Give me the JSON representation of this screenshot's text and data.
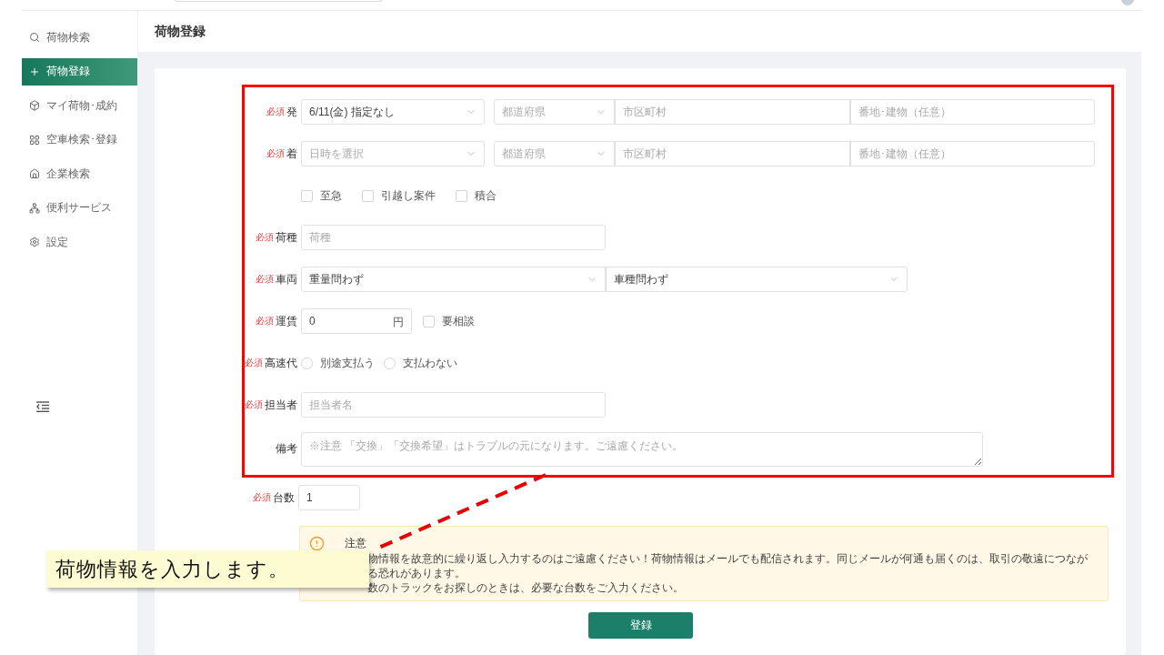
{
  "header": {
    "title": "荷物登録"
  },
  "sidebar": {
    "items": [
      {
        "label": "荷物検索",
        "selected": false
      },
      {
        "label": "荷物登録",
        "selected": true
      },
      {
        "label": "マイ荷物･成約",
        "selected": false
      },
      {
        "label": "空車検索･登録",
        "selected": false
      },
      {
        "label": "企業検索",
        "selected": false
      },
      {
        "label": "便利サービス",
        "selected": false
      },
      {
        "label": "設定",
        "selected": false
      }
    ]
  },
  "form": {
    "rows": [
      {
        "kind": "location",
        "badge": "必須",
        "label": "発",
        "date": {
          "value": "6/11(金) 指定なし"
        },
        "prefecture": {
          "placeholder": "都道府県"
        },
        "city": {
          "placeholder": "市区町村"
        },
        "address": {
          "placeholder": "番地･建物（任意）"
        }
      },
      {
        "kind": "location",
        "badge": "必須",
        "label": "着",
        "date": {
          "placeholder": "日時を選択"
        },
        "prefecture": {
          "placeholder": "都道府県"
        },
        "city": {
          "placeholder": "市区町村"
        },
        "address": {
          "placeholder": "番地･建物（任意）"
        }
      },
      {
        "kind": "checkboxes",
        "options": [
          {
            "label": "至急",
            "checked": false
          },
          {
            "label": "引越し案件",
            "checked": false
          },
          {
            "label": "積合",
            "checked": false
          }
        ]
      },
      {
        "kind": "text",
        "badge": "必須",
        "label": "荷種",
        "placeholder": "荷種"
      },
      {
        "kind": "vehicle",
        "badge": "必須",
        "label": "車両",
        "weight": "重量問わず",
        "type": "車種問わず"
      },
      {
        "kind": "fare",
        "badge": "必須",
        "label": "運賃",
        "value": "0",
        "unit": "円",
        "negotiable": {
          "label": "要相談",
          "checked": false
        }
      },
      {
        "kind": "radios",
        "badge": "必須",
        "label": "高速代",
        "options": [
          {
            "label": "別途支払う",
            "selected": false
          },
          {
            "label": "支払わない",
            "selected": false
          }
        ]
      },
      {
        "kind": "text",
        "badge": "必須",
        "label": "担当者",
        "placeholder": "担当者名"
      },
      {
        "kind": "textarea",
        "label": "備考",
        "placeholder": "※注意 「交換」「交換希望」はトラブルの元になります。ご遠慮ください。"
      }
    ],
    "count": {
      "badge": "必須",
      "label": "台数",
      "value": "1"
    }
  },
  "notice": {
    "title": "注意",
    "lines": [
      "物情報を故意的に繰り返し入力するのはご遠慮ください！荷物情報はメールでも配信されます。同じメールが何通も届くのは、取引の敬遠につながる恐れがあります。",
      "数のトラックをお探しのときは、必要な台数をご入力ください。"
    ]
  },
  "submit": {
    "label": "登録"
  },
  "callout": {
    "text": "荷物情報を入力します。"
  }
}
